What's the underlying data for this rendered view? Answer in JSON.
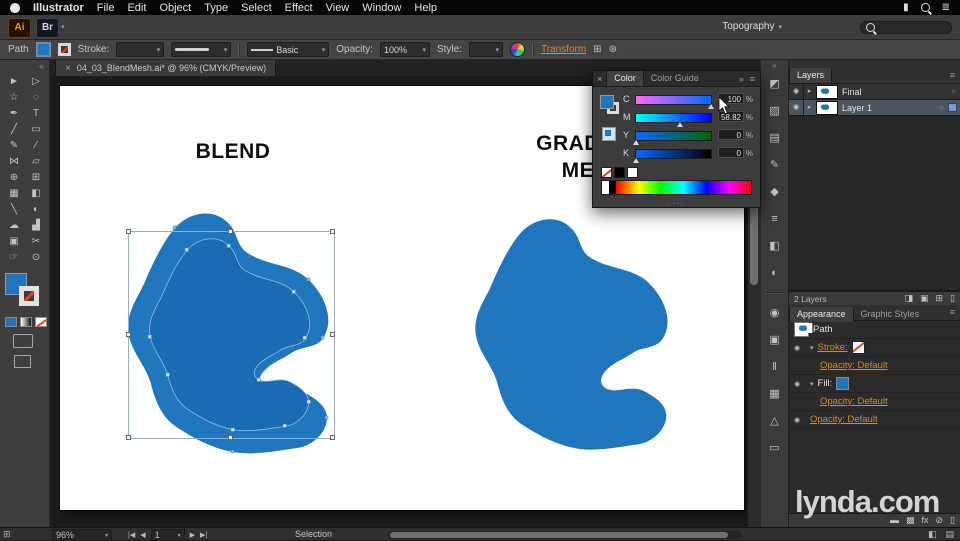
{
  "icons": {
    "dropdown": "▾",
    "expand": "▸",
    "expanded": "▾",
    "collapse_left": "«",
    "collapse_right": "»",
    "close": "×",
    "panel_menu": "≡",
    "drag_dots": "∙∙∙∙",
    "eye": "◉",
    "target": "○",
    "prev": "◀",
    "next": "▶",
    "first": "|◀",
    "last": "▶|",
    "grid": "⊞",
    "settings": "⊛",
    "corner": "⊞"
  },
  "colors": {
    "artwork_blue": "#1F76BC",
    "artwork_blue_dark": "#1A6CB2",
    "selection_outline": "#8FB0CD",
    "link_orange": "#D28C35",
    "logo_orange": "#F7941D"
  },
  "menubar": {
    "items": [
      "Illustrator",
      "File",
      "Edit",
      "Object",
      "Type",
      "Select",
      "Effect",
      "View",
      "Window",
      "Help"
    ],
    "status_icons": [
      {
        "name": "battery-icon",
        "glyph": "▮"
      },
      {
        "name": "spotlight-search-icon",
        "type": "mag"
      },
      {
        "name": "notification-center-icon",
        "glyph": "≣"
      }
    ]
  },
  "appbar": {
    "ai_label": "Ai",
    "br_label": "Br",
    "workspace_label": "Topography"
  },
  "controlbar": {
    "selection_type": "Path",
    "stroke_label": "Stroke:",
    "brush_name": "Basic",
    "opacity_label": "Opacity:",
    "opacity_value": "100%",
    "style_label": "Style:",
    "transform_link": "Transform"
  },
  "tabbar": {
    "title": "04_03_BlendMesh.ai* @ 96% (CMYK/Preview)"
  },
  "toolbar": {
    "tools": [
      {
        "name": "selection-tool",
        "glyph": "►"
      },
      {
        "name": "direct-selection-tool",
        "glyph": "▷"
      },
      {
        "name": "magic-wand-tool",
        "glyph": "☆"
      },
      {
        "name": "lasso-tool",
        "glyph": "◌"
      },
      {
        "name": "pen-tool",
        "glyph": "✒"
      },
      {
        "name": "type-tool",
        "glyph": "T"
      },
      {
        "name": "line-segment-tool",
        "glyph": "╱"
      },
      {
        "name": "rectangle-tool",
        "glyph": "▭"
      },
      {
        "name": "paintbrush-tool",
        "glyph": "✎"
      },
      {
        "name": "pencil-tool",
        "glyph": "⁄"
      },
      {
        "name": "width-tool",
        "glyph": "⋈"
      },
      {
        "name": "free-transform-tool",
        "glyph": "▱"
      },
      {
        "name": "shape-builder-tool",
        "glyph": "⊕"
      },
      {
        "name": "perspective-grid-tool",
        "glyph": "⊞"
      },
      {
        "name": "mesh-tool",
        "glyph": "▦"
      },
      {
        "name": "gradient-tool",
        "glyph": "◧"
      },
      {
        "name": "eyedropper-tool",
        "glyph": "╲"
      },
      {
        "name": "blend-tool",
        "glyph": "◐"
      },
      {
        "name": "symbol-sprayer-tool",
        "glyph": "☁"
      },
      {
        "name": "column-graph-tool",
        "glyph": "▟"
      },
      {
        "name": "artboard-tool",
        "glyph": "▣"
      },
      {
        "name": "slice-tool",
        "glyph": "✂"
      },
      {
        "name": "hand-tool",
        "glyph": "☞"
      },
      {
        "name": "zoom-tool",
        "glyph": "⊙"
      }
    ]
  },
  "canvas": {
    "blend_label": "BLEND",
    "mesh_label_line1": "GRADIENT",
    "mesh_label_line2": "MESH"
  },
  "color_panel": {
    "tabs": [
      {
        "label": "Color",
        "active": true
      },
      {
        "label": "Color Guide",
        "active": false
      }
    ],
    "sliders": [
      {
        "label": "C",
        "value": "100",
        "pct": 100,
        "from": "#ff69ff",
        "to": "#0069ff"
      },
      {
        "label": "M",
        "value": "58.82",
        "pct": 59,
        "from": "#00ffff",
        "to": "#0000ff"
      },
      {
        "label": "Y",
        "value": "0",
        "pct": 0,
        "from": "#0069ff",
        "to": "#006400"
      },
      {
        "label": "K",
        "value": "0",
        "pct": 0,
        "from": "#0069ff",
        "to": "#000000"
      }
    ],
    "unit": "%"
  },
  "dock": {
    "icons": [
      {
        "name": "color-panel-icon",
        "glyph": "◩"
      },
      {
        "name": "color-guide-panel-icon",
        "glyph": "▧"
      },
      {
        "name": "swatches-panel-icon",
        "glyph": "▤"
      },
      {
        "name": "brushes-panel-icon",
        "glyph": "✎"
      },
      {
        "name": "symbols-panel-icon",
        "glyph": "◆"
      },
      {
        "name": "stroke-panel-icon",
        "glyph": "≡"
      },
      {
        "name": "gradient-panel-icon",
        "glyph": "◧"
      },
      {
        "name": "transparency-panel-icon",
        "glyph": "◐"
      },
      {
        "divider": true
      },
      {
        "name": "appearance-panel-icon",
        "glyph": "◉"
      },
      {
        "name": "graphic-styles-panel-icon",
        "glyph": "▣"
      },
      {
        "name": "align-panel-icon",
        "glyph": "‖"
      },
      {
        "name": "pathfinder-panel-icon",
        "glyph": "▦"
      },
      {
        "name": "transform-panel-icon",
        "glyph": "△"
      },
      {
        "name": "artboards-panel-icon",
        "glyph": "▭"
      }
    ]
  },
  "layers_panel": {
    "title": "Layers",
    "rows": [
      {
        "name": "Final",
        "selected": false
      },
      {
        "name": "Layer 1",
        "selected": true
      }
    ],
    "status": "2 Layers",
    "footer_icons": [
      {
        "name": "make-clipping-mask-icon",
        "glyph": "◨"
      },
      {
        "name": "new-sublayer-icon",
        "glyph": "▣"
      },
      {
        "name": "new-layer-icon",
        "glyph": "⊞"
      },
      {
        "name": "delete-layer-icon",
        "glyph": "▯"
      }
    ]
  },
  "appearance_panel": {
    "tabs": [
      {
        "label": "Appearance",
        "active": true
      },
      {
        "label": "Graphic Styles",
        "active": false
      }
    ],
    "rows": [
      {
        "type": "header",
        "label": "Path",
        "thumb": true
      },
      {
        "eye": true,
        "arrow": "▾",
        "label": "Stroke:",
        "link": true,
        "swatch": "none"
      },
      {
        "indent": 2,
        "label": "Opacity:",
        "value": "Default",
        "link": true
      },
      {
        "eye": true,
        "arrow": "▾",
        "label": "Fill:",
        "link": false,
        "swatch": "fill"
      },
      {
        "indent": 2,
        "label": "Opacity:",
        "value": "Default",
        "link": true
      },
      {
        "eye": true,
        "label": "Opacity:",
        "value": "Default",
        "link": true
      }
    ],
    "footer_icons": [
      {
        "name": "new-stroke-icon",
        "glyph": "▬"
      },
      {
        "name": "new-fill-icon",
        "glyph": "▩"
      },
      {
        "name": "add-effect-icon",
        "glyph": "fx"
      },
      {
        "name": "clear-appearance-icon",
        "glyph": "⊘"
      },
      {
        "name": "delete-item-icon",
        "glyph": "▯"
      }
    ]
  },
  "statusbar": {
    "zoom": "96%",
    "artboard_value": "1",
    "status_text": "Selection",
    "right_icons": [
      {
        "name": "screen-mode-icon",
        "glyph": "◧"
      },
      {
        "name": "grid-view-icon",
        "glyph": "▤"
      }
    ]
  },
  "watermark": {
    "text": "lynda.com"
  }
}
